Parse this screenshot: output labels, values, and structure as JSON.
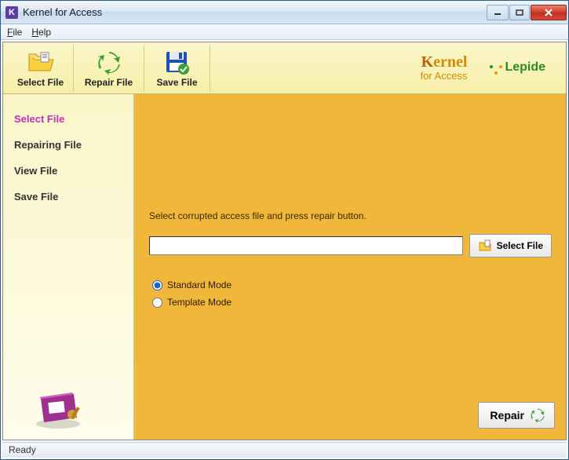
{
  "window": {
    "title": "Kernel for Access"
  },
  "menu": {
    "file": "File",
    "help": "Help"
  },
  "toolbar": {
    "select_file": "Select File",
    "repair_file": "Repair File",
    "save_file": "Save File"
  },
  "brand": {
    "kernel_top": "Kernel",
    "kernel_sub": "for Access",
    "lepide": "Lepide"
  },
  "sidebar": {
    "steps": [
      {
        "label": "Select File",
        "active": true
      },
      {
        "label": "Repairing File",
        "active": false
      },
      {
        "label": "View File",
        "active": false
      },
      {
        "label": "Save File",
        "active": false
      }
    ]
  },
  "main": {
    "instruction": "Select corrupted access file and press repair button.",
    "file_path": "",
    "select_button": "Select File",
    "modes": {
      "standard": "Standard Mode",
      "template": "Template Mode",
      "selected": "standard"
    },
    "repair_button": "Repair"
  },
  "statusbar": {
    "text": "Ready"
  }
}
